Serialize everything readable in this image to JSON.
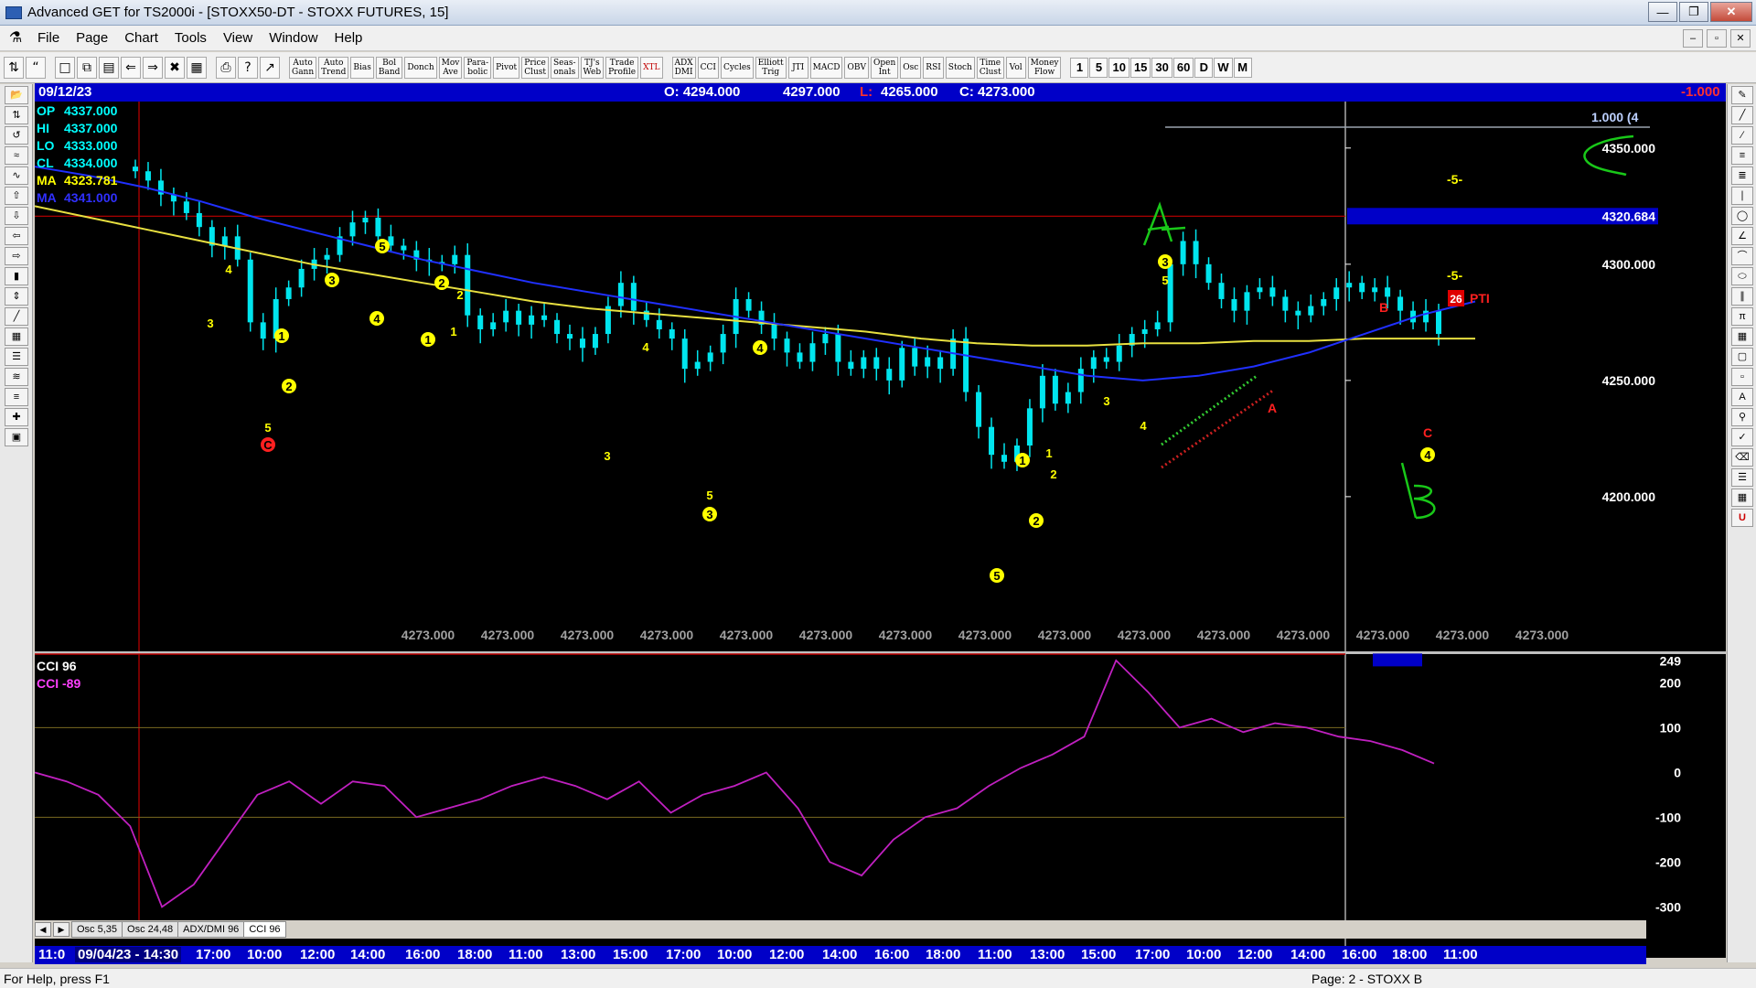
{
  "window": {
    "title": "Advanced GET for TS2000i - [STOXX50-DT - STOXX FUTURES, 15]"
  },
  "menu": [
    "File",
    "Page",
    "Chart",
    "Tools",
    "View",
    "Window",
    "Help"
  ],
  "toolbar": {
    "studies": [
      "Auto\nGann",
      "Auto\nTrend",
      "Bias",
      "Bol\nBand",
      "Donch",
      "Mov\nAve",
      "Para-\nbolic",
      "Pivot",
      "Price\nClust",
      "Seas-\nonals",
      "TJ's\nWeb",
      "Trade\nProfile",
      "XTL",
      "ADX\nDMI",
      "CCI",
      "Cycles",
      "Elliott\nTrig",
      "JTI",
      "MACD",
      "OBV",
      "Open\nInt",
      "Osc",
      "RSI",
      "Stoch",
      "Time\nClust",
      "Vol",
      "Money\nFlow"
    ],
    "timeframes": [
      "1",
      "5",
      "10",
      "15",
      "30",
      "60",
      "D",
      "W",
      "M"
    ]
  },
  "infobar": {
    "date": "09/12/23",
    "open": "O: 4294.000",
    "high": "4297.000",
    "low_label": "L:",
    "low": "4265.000",
    "close": "C: 4273.000",
    "change": "-1.000"
  },
  "legend": [
    {
      "label": "OP",
      "value": "4337.000",
      "color": "#00ffff"
    },
    {
      "label": "HI",
      "value": "4337.000",
      "color": "#00ffff"
    },
    {
      "label": "LO",
      "value": "4333.000",
      "color": "#00ffff"
    },
    {
      "label": "CL",
      "value": "4334.000",
      "color": "#00ffff"
    },
    {
      "label": "MA",
      "value": "4323.781",
      "color": "#ffff00"
    },
    {
      "label": "MA",
      "value": "4341.000",
      "color": "#3030ff"
    }
  ],
  "price_axis": {
    "ticks": [
      "4350.000",
      "4300.000",
      "4250.000",
      "4200.000"
    ],
    "highlight": "4320.684",
    "top_label": "1.000 (4"
  },
  "bottom_values": [
    "4273.000",
    "4273.000",
    "4273.000",
    "4273.000",
    "4273.000",
    "4273.000",
    "4273.000",
    "4273.000",
    "4273.000",
    "4273.000",
    "4273.000",
    "4273.000",
    "4273.000",
    "4273.000",
    "4273.000"
  ],
  "annotations": {
    "pti_num": "26",
    "pti_label": "PTI",
    "five_a": "-5-",
    "five_b": "-5-"
  },
  "cci": {
    "title1": "CCI 96",
    "title2": "CCI -89",
    "ticks": [
      "249",
      "200",
      "100",
      "0",
      "-100",
      "-200",
      "-300"
    ]
  },
  "tabs": [
    "Osc 5,35",
    "Osc 24,48",
    "ADX/DMI 96",
    "CCI 96"
  ],
  "timeline": [
    "11:0",
    "09/04/23 - 14:30",
    "17:00",
    "10:00",
    "12:00",
    "14:00",
    "16:00",
    "18:00",
    "11:00",
    "13:00",
    "15:00",
    "17:00",
    "10:00",
    "12:00",
    "14:00",
    "16:00",
    "18:00",
    "11:00",
    "13:00",
    "15:00",
    "17:00",
    "10:00",
    "12:00",
    "14:00",
    "16:00",
    "18:00",
    "11:00"
  ],
  "status": {
    "left": "For Help, press F1",
    "right": "Page: 2 - STOXX B"
  },
  "chart_data": {
    "type": "line",
    "title": "STOXX50-DT - STOXX FUTURES, 15",
    "ylim": [
      4185,
      4370
    ],
    "series": [
      {
        "name": "close",
        "values": [
          4340,
          4336,
          4330,
          4327,
          4322,
          4316,
          4308,
          4312,
          4302,
          4275,
          4268,
          4285,
          4290,
          4298,
          4302,
          4304,
          4312,
          4318,
          4320,
          4312,
          4308,
          4306,
          4302,
          4301,
          4300,
          4304,
          4278,
          4272,
          4275,
          4280,
          4274,
          4278,
          4276,
          4270,
          4268,
          4264,
          4270,
          4282,
          4292,
          4280,
          4276,
          4272,
          4268,
          4255,
          4258,
          4262,
          4270,
          4285,
          4280,
          4274,
          4268,
          4262,
          4258,
          4266,
          4270,
          4258,
          4255,
          4260,
          4255,
          4250,
          4264,
          4256,
          4260,
          4255,
          4268,
          4245,
          4230,
          4218,
          4215,
          4222,
          4238,
          4252,
          4240,
          4245,
          4255,
          4260,
          4258,
          4265,
          4270,
          4272,
          4275,
          4300,
          4310,
          4300,
          4292,
          4285,
          4280,
          4288,
          4290,
          4286,
          4280,
          4278,
          4282,
          4285,
          4290,
          4292,
          4288,
          4290,
          4286,
          4280,
          4275,
          4280,
          4270
        ]
      },
      {
        "name": "MA 4323.781",
        "values": [
          4325,
          4320,
          4315,
          4310,
          4305,
          4300,
          4296,
          4292,
          4288,
          4284,
          4281,
          4279,
          4277,
          4275,
          4273,
          4271,
          4268,
          4266,
          4265,
          4265,
          4266,
          4266,
          4267,
          4267,
          4268,
          4268,
          4268
        ]
      },
      {
        "name": "MA 4341.000",
        "values": [
          4342,
          4338,
          4333,
          4327,
          4320,
          4314,
          4308,
          4302,
          4297,
          4292,
          4288,
          4284,
          4280,
          4276,
          4272,
          4268,
          4264,
          4260,
          4256,
          4252,
          4250,
          4252,
          4256,
          4262,
          4270,
          4278,
          4284
        ]
      }
    ],
    "cci_values": [
      0,
      -20,
      -50,
      -120,
      -300,
      -250,
      -150,
      -50,
      -20,
      -70,
      -20,
      -30,
      -100,
      -80,
      -60,
      -30,
      -10,
      -30,
      -60,
      -20,
      -90,
      -50,
      -30,
      0,
      -80,
      -200,
      -230,
      -150,
      -100,
      -80,
      -30,
      10,
      40,
      80,
      250,
      180,
      100,
      120,
      90,
      110,
      100,
      80,
      70,
      50,
      20
    ]
  }
}
